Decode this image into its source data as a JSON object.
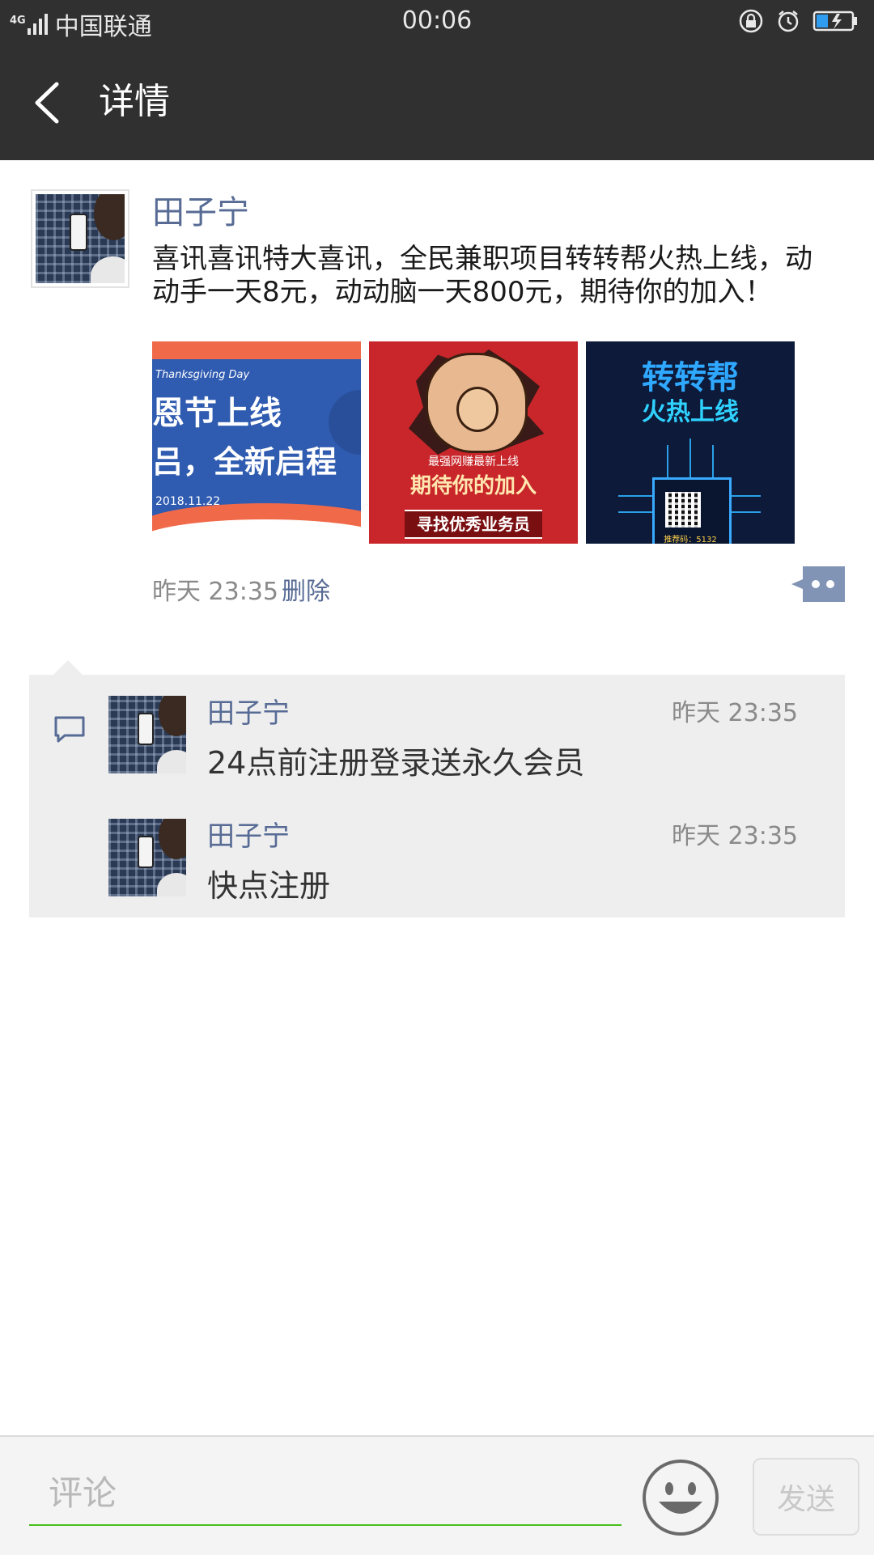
{
  "status_bar": {
    "network": "4G",
    "carrier": "中国联通",
    "time": "00:06",
    "icons": [
      "signal-icon",
      "rotation-lock-icon",
      "alarm-icon",
      "battery-charging-icon"
    ]
  },
  "header": {
    "back_icon": "chevron-left-icon",
    "title": "详情"
  },
  "post": {
    "author": "田子宁",
    "text": "喜讯喜讯特大喜讯，全民兼职项目转转帮火热上线，动动手一天8元，动动脑一天800元，期待你的加入！",
    "images": [
      {
        "line1": "Thanksgiving Day",
        "line2": "恩节上线",
        "line3": "吕，全新启程",
        "line4": "2018.11.22"
      },
      {
        "line1": "最强网赚最新上线",
        "line2": "期待你的加入",
        "line3": "寻找优秀业务员"
      },
      {
        "line1": "转转帮",
        "line2": "火热上线",
        "line3": "推荐码：5132"
      }
    ],
    "time": "昨天 23:35",
    "delete_label": "删除",
    "more_icon": "more-dots-icon"
  },
  "comments": {
    "icon": "comment-icon",
    "items": [
      {
        "name": "田子宁",
        "time": "昨天 23:35",
        "text": "24点前注册登录送永久会员"
      },
      {
        "name": "田子宁",
        "time": "昨天 23:35",
        "text": "快点注册"
      }
    ]
  },
  "input_bar": {
    "placeholder": "评论",
    "emoji_icon": "emoji-smile-icon",
    "send_label": "发送",
    "accent_color": "#45c01a"
  },
  "colors": {
    "header_bg": "#303030",
    "name_color": "#576b95",
    "comment_bg": "#eeeeee"
  }
}
